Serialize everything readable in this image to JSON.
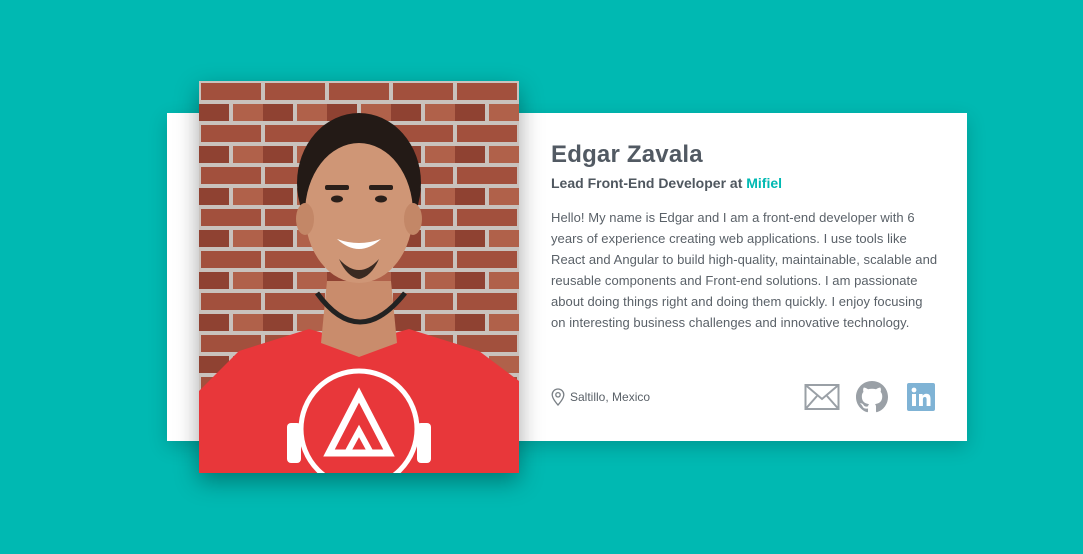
{
  "profile": {
    "name": "Edgar Zavala",
    "role_prefix": "Lead Front-End Developer at ",
    "company": "Mifiel",
    "bio": "Hello! My name is Edgar and I am a front-end developer with 6 years of experience creating web applications. I use tools like React and Angular to build high-quality, maintainable, scalable and reusable components and Front-end solutions. I am passionate about doing things right and doing them quickly. I enjoy focusing on interesting business challenges and innovative technology.",
    "location": "Saltillo, Mexico"
  },
  "socials": [
    {
      "icon": "mail-icon"
    },
    {
      "icon": "github-icon"
    },
    {
      "icon": "linkedin-icon"
    }
  ],
  "colors": {
    "background": "#00b9b2",
    "accent": "#00b9b2",
    "text": "#525a63",
    "linkedin": "#7fb3d5",
    "icon_gray": "#9aa0a6"
  }
}
